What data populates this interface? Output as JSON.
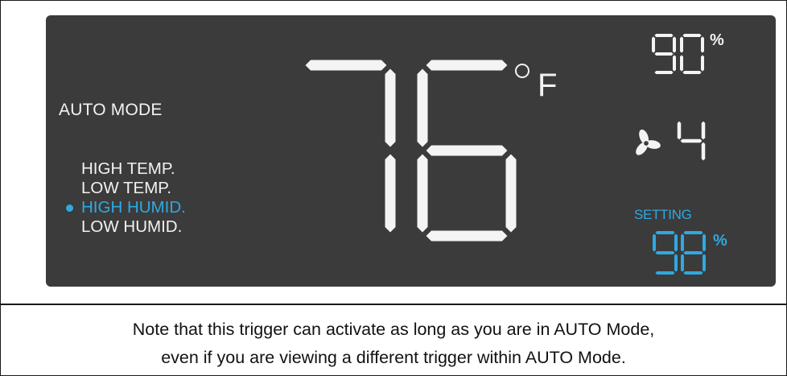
{
  "display": {
    "temperature": "76",
    "temperature_unit": "F",
    "humidity": "90",
    "humidity_unit": "%",
    "fan_speed": "4",
    "setting_label": "SETTING",
    "setting_humidity": "98",
    "setting_unit": "%"
  },
  "mode": {
    "label": "AUTO MODE",
    "triggers": [
      {
        "label": "HIGH TEMP.",
        "active": false
      },
      {
        "label": "LOW TEMP.",
        "active": false
      },
      {
        "label": "HIGH HUMID.",
        "active": true
      },
      {
        "label": "LOW HUMID.",
        "active": false
      }
    ]
  },
  "note": {
    "line1": "Note that this trigger can activate as long as you are in AUTO Mode,",
    "line2": "even if you are viewing a different trigger within AUTO Mode."
  },
  "colors": {
    "panel_bg": "#3b3b3b",
    "segment_white": "#f4f4f4",
    "accent_blue": "#2fa9e0"
  },
  "icons": {
    "fan": "fan-icon",
    "active_indicator": "dot-indicator"
  }
}
